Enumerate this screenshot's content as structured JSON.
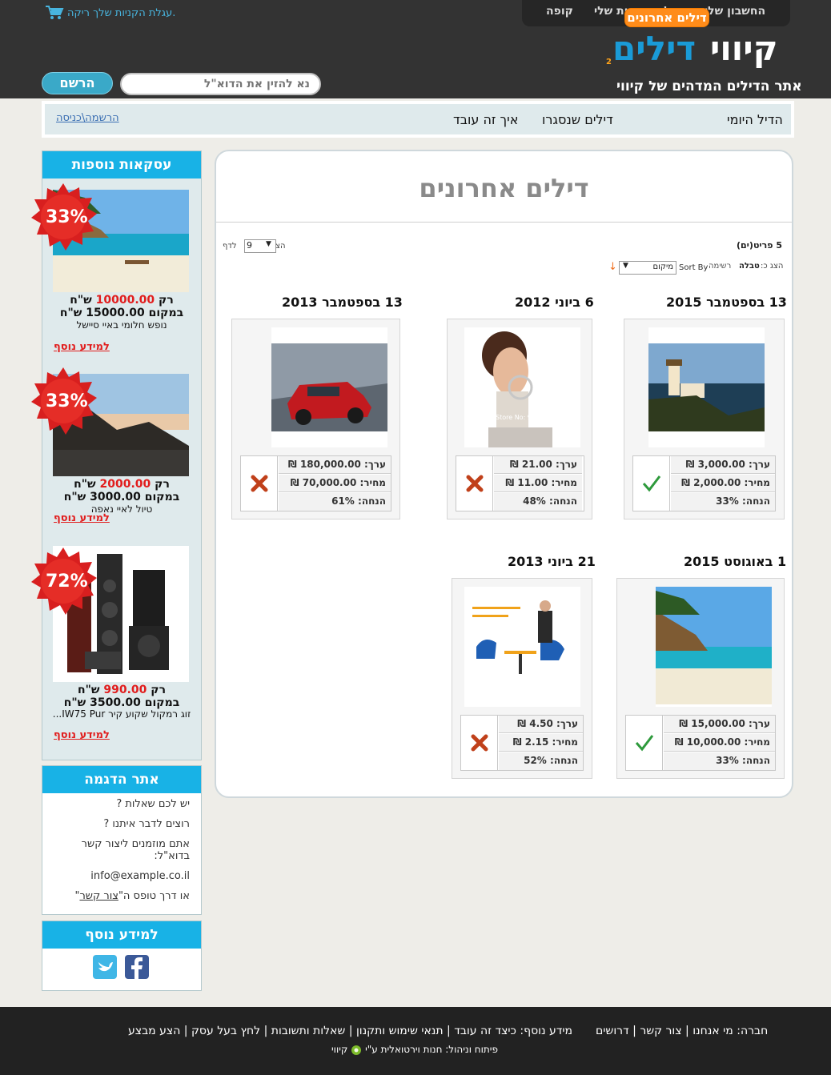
{
  "header": {
    "topnav": [
      "החשבון שלי",
      "עגלת הקניות שלי",
      "קופה"
    ],
    "cart_text": "עגלת הקניות שלך ריקה.",
    "logo_kivui": "קיווי",
    "logo_deals": "דילים",
    "logo_sub": "2",
    "tagline": "אתר הדילים המדהים של קיווי",
    "email_placeholder": "נא להזין את הדוא\"ל",
    "register_label": "הרשם"
  },
  "menu": {
    "items": [
      "הדיל היומי",
      "דילים אחרונים",
      "דילים שנסגרו",
      "איך זה עובד"
    ],
    "active": "דילים אחרונים",
    "login": "הרשמה\\כניסה"
  },
  "sidebar": {
    "more_deals_title": "עסקאות נוספות",
    "deals": [
      {
        "discount": "33%",
        "price_prefix": "רק",
        "price": "10000.00",
        "currency": "ש\"ח",
        "was": "במקום 15000.00 ש\"ח",
        "name": "נופש חלומי באיי סיישל",
        "more": "למידע נוסף",
        "image": "beach-hut-photo"
      },
      {
        "discount": "33%",
        "price_prefix": "רק",
        "price": "2000.00",
        "currency": "ש\"ח",
        "was": "במקום 3000.00 ש\"ח",
        "name": "טיול לאיי נאפה",
        "more": "למידע נוסף",
        "image": "coast-sunset-photo"
      },
      {
        "discount": "72%",
        "price_prefix": "רק",
        "price": "990.00",
        "currency": "ש\"ח",
        "was": "במקום 3500.00 ש\"ח",
        "name": "זוג רמקול שקוע קיר IW75 Pur...",
        "more": "למידע נוסף",
        "image": "speakers-photo"
      }
    ],
    "demo_title": "אתר הדגמה",
    "demo_lines": [
      "יש לכם שאלות ?",
      "רוצים לדבר איתנו ?",
      "אתם מוזמנים ליצור קשר בדוא\"ל:",
      "info@example.co.il"
    ],
    "demo_form_prefix": "או דרך טופס ה\"",
    "demo_form_link": "צור קשר",
    "demo_form_suffix": "\"",
    "info_title": "למידע נוסף",
    "social": [
      "twitter-icon",
      "facebook-icon"
    ]
  },
  "main": {
    "title": "דילים אחרונים",
    "items_count": "5 פריט(ים)",
    "show_label": "הצג",
    "per_page": "9",
    "per_page_label": "לדף",
    "view_label": "הצג כ:",
    "view_table": "טבלה",
    "view_list": "רשימה",
    "sort_by": "Sort By",
    "sort_value": "מיקום",
    "cards": [
      {
        "date": "13 בספטמבר 2015",
        "value": "ערך: 3,000.00 ₪",
        "price": "מחיר: 2,000.00 ₪",
        "discount": "הנחה: 33%",
        "status": "active",
        "image": "lighthouse-photo"
      },
      {
        "date": "6 ביוני 2012",
        "value": "ערך: 21.00 ₪",
        "price": "מחיר: 11.00 ₪",
        "discount": "הנחה: 48%",
        "status": "closed",
        "image": "woman-beauty-photo",
        "image_caption": "Store No: 907475"
      },
      {
        "date": "13 בספטמבר 2013",
        "value": "ערך: 180,000.00 ₪",
        "price": "מחיר: 70,000.00 ₪",
        "discount": "הנחה: 61%",
        "status": "closed",
        "image": "red-car-photo"
      },
      {
        "date": "1 באוגוסט 2015",
        "value": "ערך: 15,000.00 ₪",
        "price": "מחיר: 10,000.00 ₪",
        "discount": "הנחה: 33%",
        "status": "active",
        "image": "beach-hut-photo"
      },
      {
        "date": "21 ביוני 2013",
        "value": "ערך: 4.50 ₪",
        "price": "מחיר: 2.15 ₪",
        "discount": "הנחה: 52%",
        "status": "closed",
        "image": "businessman-chairs-photo"
      }
    ]
  },
  "footer": {
    "company_label": "חברה:",
    "company_links": [
      "מי אנחנו",
      "צור קשר",
      "דרושים"
    ],
    "info_label": "מידע נוסף:",
    "info_links": [
      "כיצד זה עובד",
      "תנאי שימוש ותקנון",
      "שאלות ותשובות",
      "לחץ בעל עסק",
      "הצע מבצע"
    ],
    "credit": "פיתוח וניהול: חנות וירטואלית ע\"י",
    "credit_brand": "קיווי"
  },
  "colors": {
    "header_bg": "#333333",
    "accent_blue": "#18b2e6",
    "accent_orange": "#ff8c1a",
    "price_red": "#e11d1d",
    "footer_bg": "#222222"
  }
}
